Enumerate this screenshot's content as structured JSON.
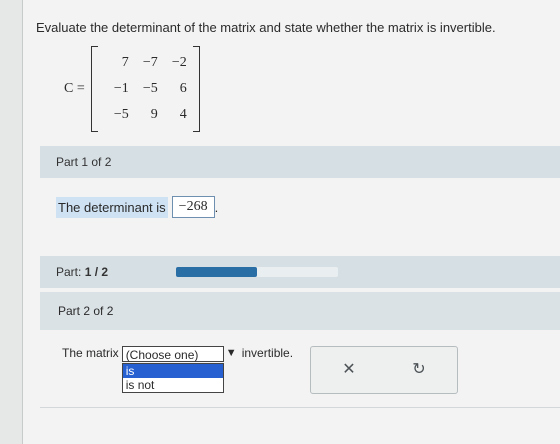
{
  "prompt": "Evaluate the determinant of the matrix and state whether the matrix is invertible.",
  "matrix": {
    "label": "C =",
    "rows": [
      [
        "7",
        "−7",
        "−2"
      ],
      [
        "−1",
        "−5",
        "6"
      ],
      [
        "−5",
        "9",
        "4"
      ]
    ]
  },
  "part1": {
    "header": "Part 1 of 2",
    "det_text": "The determinant is",
    "det_value": "−268",
    "period": "."
  },
  "progress": {
    "label": "Part:",
    "value": "1 / 2",
    "fraction": 0.5
  },
  "part2": {
    "header": "Part 2 of 2",
    "prefix": "The matrix",
    "select_placeholder": "(Choose one)",
    "options": [
      "is",
      "is not"
    ],
    "suffix": "invertible."
  },
  "buttons": {
    "clear": "✕",
    "retry": "↻"
  }
}
